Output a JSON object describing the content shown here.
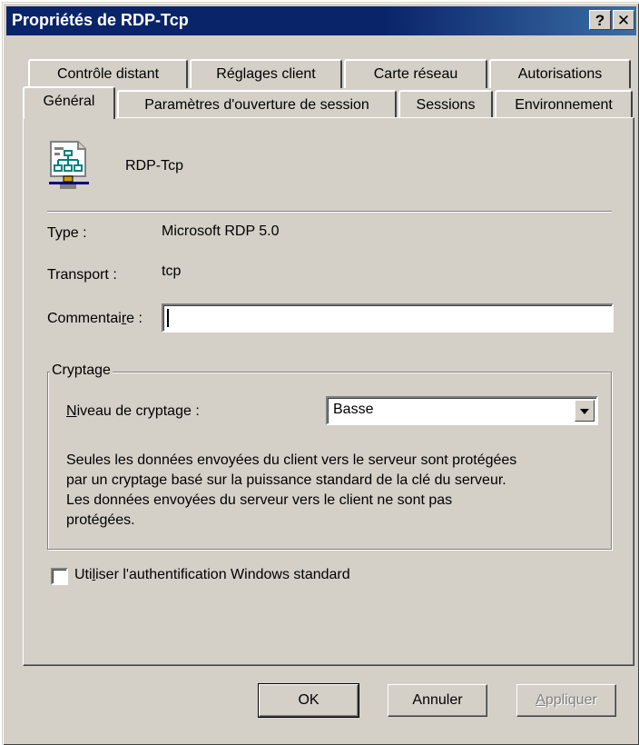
{
  "window": {
    "title": "Propriétés de RDP-Tcp",
    "help_glyph": "?",
    "close_glyph": "✕"
  },
  "tabs_back": [
    "Contrôle distant",
    "Réglages client",
    "Carte réseau",
    "Autorisations"
  ],
  "tabs_front": [
    "Général",
    "Paramètres d'ouverture de session",
    "Sessions",
    "Environnement"
  ],
  "active_tab": "Général",
  "general": {
    "connection_name": "RDP-Tcp",
    "type_label": "Type :",
    "type_value": "Microsoft RDP 5.0",
    "transport_label": "Transport :",
    "transport_value": "tcp",
    "comment_label_pre": "Commentai",
    "comment_label_key": "r",
    "comment_label_post": "e :",
    "comment_value": ""
  },
  "encryption": {
    "group_title": "Cryptage",
    "level_label_key": "N",
    "level_label_rest": "iveau de cryptage :",
    "level_value": "Basse",
    "description_lines": [
      "Seules les données envoyées du client vers le serveur sont protégées",
      "par un cryptage basé sur la puissance standard de la clé du serveur.",
      "Les données envoyées du serveur vers le client ne sont pas",
      "protégées."
    ]
  },
  "auth": {
    "label_pre": "Uti",
    "label_key": "l",
    "label_post": "iser l'authentification Windows standard",
    "checked": false
  },
  "buttons": {
    "ok": "OK",
    "cancel": "Annuler",
    "apply_key": "A",
    "apply_rest": "ppliquer"
  },
  "icons": [
    "network-connection-icon",
    "help-icon",
    "close-icon",
    "chevron-down-icon"
  ]
}
